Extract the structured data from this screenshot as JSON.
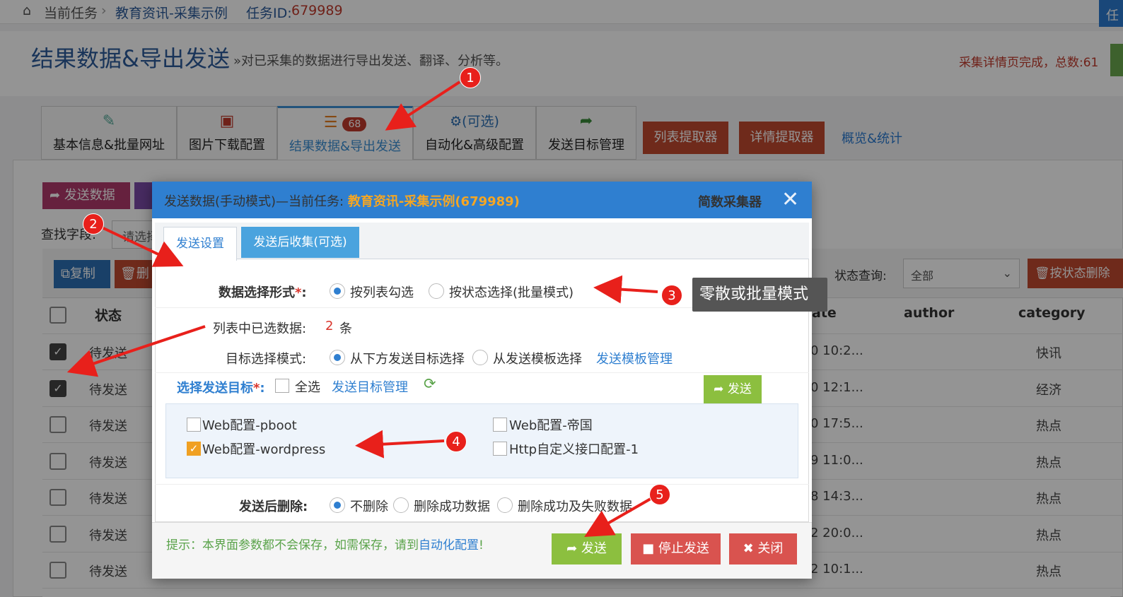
{
  "breadcrumb": {
    "home": "当前任务",
    "task": "教育资讯-采集示例",
    "task_id_label": "任务ID:",
    "task_id": "679989",
    "right_btn": "任"
  },
  "header": {
    "title": "结果数据&导出发送",
    "desc": "»对已采集的数据进行导出发送、翻译、分析等。",
    "status_note": "采集详情页完成，总数:61"
  },
  "tabs": [
    {
      "label": "基本信息&批量网址"
    },
    {
      "label": "图片下载配置"
    },
    {
      "label": "结果数据&导出发送",
      "badge": "68"
    },
    {
      "label": "自动化&高级配置",
      "note": "(可选)"
    },
    {
      "label": "发送目标管理"
    }
  ],
  "toolbar": {
    "list_extractor": "列表提取器",
    "detail_extractor": "详情提取器",
    "overview": "概览&统计"
  },
  "page": {
    "send_data": "发送数据",
    "find_label": "查找字段:",
    "find_placeholder": "请选择",
    "copy": "复制",
    "delete": "删除",
    "status_query": "状态查询:",
    "status_all": "全部",
    "delete_by_status": "按状态删除"
  },
  "table": {
    "headers": [
      "状态",
      "ate",
      "author",
      "category"
    ],
    "rows": [
      {
        "checked": true,
        "status": "待发送",
        "date": "0 10:2...",
        "category": "快讯"
      },
      {
        "checked": true,
        "status": "待发送",
        "date": "0 12:1...",
        "category": "经济"
      },
      {
        "checked": false,
        "status": "待发送",
        "date": "0 17:5...",
        "category": "热点"
      },
      {
        "checked": false,
        "status": "待发送",
        "date": "9 11:0...",
        "category": "热点"
      },
      {
        "checked": false,
        "status": "待发送",
        "date": "8 14:3...",
        "category": "热点"
      },
      {
        "checked": false,
        "status": "待发送",
        "date": "2 20:0...",
        "category": "热点"
      },
      {
        "checked": false,
        "status": "待发送",
        "date": "2 10:1...",
        "category": "热点"
      }
    ]
  },
  "modal": {
    "title_prefix": "发送数据(手动模式)—当前任务: ",
    "title_task": "教育资讯-采集示例(679989)",
    "brand": "简数采集器",
    "close_icon": "✕",
    "tab_send": "发送设置",
    "tab_collect": "发送后收集(可选)",
    "select_mode_label": "数据选择形式",
    "select_mode_opts": [
      "按列表勾选",
      "按状态选择(批量模式)"
    ],
    "selected_label": "列表中已选数据:",
    "selected_count": "2",
    "selected_unit": "条",
    "target_mode_label": "目标选择模式:",
    "target_mode_opts": [
      "从下方发送目标选择",
      "从发送模板选择"
    ],
    "template_link": "发送模板管理",
    "choose_target_label": "选择发送目标",
    "select_all": "全选",
    "target_manage_link": "发送目标管理",
    "send_small": "发送",
    "targets": [
      {
        "label": "Web配置-pboot",
        "checked": false
      },
      {
        "label": "Web配置-帝国",
        "checked": false
      },
      {
        "label": "Web配置-wordpress",
        "checked": true
      },
      {
        "label": "Http自定义接口配置-1",
        "checked": false
      }
    ],
    "after_delete_label": "发送后删除:",
    "after_delete_opts": [
      "不删除",
      "删除成功数据",
      "删除成功及失败数据"
    ],
    "tip_prefix": "提示：本界面参数都不会保存，如需保存，请到",
    "tip_link": "自动化配置",
    "tip_suffix": "!",
    "btn_send": "发送",
    "btn_stop": "停止发送",
    "btn_close": "关闭"
  },
  "annotations": {
    "badges": [
      "1",
      "2",
      "3",
      "4",
      "5"
    ],
    "tooltip": "零散或批量模式"
  },
  "colors": {
    "primary": "#2f7fd0",
    "danger": "#d9534f",
    "success": "#8cbf3f",
    "annotation": "#e8201b"
  }
}
